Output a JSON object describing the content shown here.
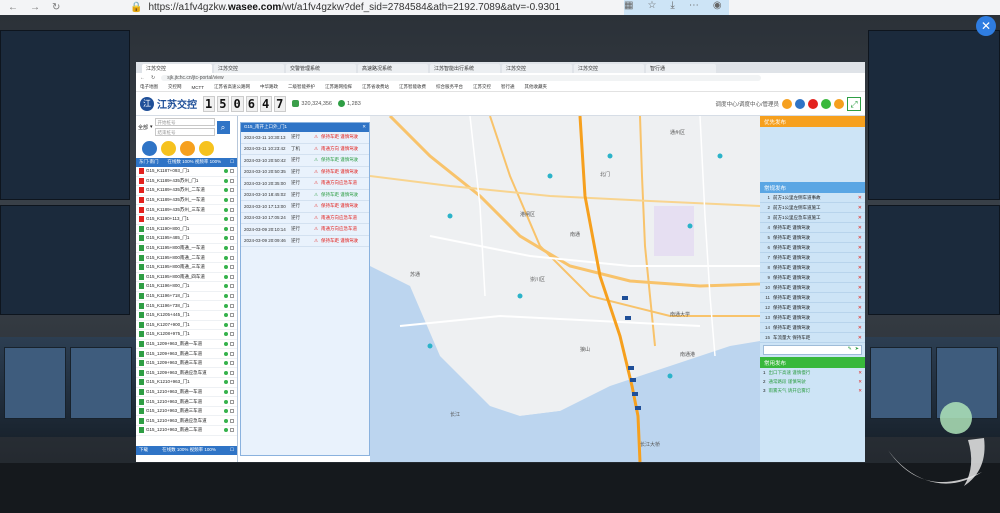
{
  "outer_browser": {
    "url_prefix": "https://a1fv4gzkw.",
    "url_domain": "wasee.com",
    "url_rest": "/wt/a1fv4gzkw?def_sid=2784584&ath=2192.7089&atv=-0.9301"
  },
  "inner_browser": {
    "tabs": [
      "江苏交控",
      "江苏交控",
      "交警管理系统",
      "高速路况系统",
      "江苏智能出行系统",
      "江苏交控",
      "江苏交控",
      "智行通"
    ],
    "address": "sjk.jtchc.cn/jtc-portal/view",
    "bookmarks": [
      "电子地图",
      "交控网",
      "MCTT",
      "江苏省高速公路网",
      "中华路政",
      "二级智能养护",
      "江苏路网指挥",
      "江苏省收费站",
      "江苏智能收费",
      "综合服务平台",
      "江苏交控",
      "智行通",
      "其他收藏夹"
    ]
  },
  "app": {
    "brand_seal": "江",
    "brand_name": "江苏交控",
    "clock": [
      "1",
      "5",
      "0",
      "6",
      "4",
      "7"
    ],
    "stat_a": "320,324,356",
    "stat_b": "1,283",
    "header_right": "调度中心/调度中心/管理员",
    "expand_icon": "⤢"
  },
  "left_panel": {
    "dropdown": "全部",
    "start_placeholder": "开始桩号",
    "end_placeholder": "结束桩号",
    "search_icon": "⌕",
    "list_header_left": "东门-南门",
    "list_header_mid": "在线数 100% 视频率 100%",
    "rows": [
      {
        "label": "G15_K1187+093_门1",
        "tag": "#e3211d"
      },
      {
        "label": "G15_K1189+435苏州_门1",
        "tag": "#e3211d"
      },
      {
        "label": "G15_K1189+435苏州_二车道",
        "tag": "#e3211d"
      },
      {
        "label": "G15_K1189+435苏州_一车道",
        "tag": "#e3211d"
      },
      {
        "label": "G15_K1189+435苏州_三车道",
        "tag": "#e3211d"
      },
      {
        "label": "G15_K1190+113_门1",
        "tag": "#e3211d"
      },
      {
        "label": "G15_K1190+800_门1",
        "tag": "#2e9e44"
      },
      {
        "label": "G15_K1195+485_门1",
        "tag": "#2e9e44"
      },
      {
        "label": "G15_K1195+800南通_一车道",
        "tag": "#2e9e44"
      },
      {
        "label": "G15_K1195+800南通_二车道",
        "tag": "#2e9e44"
      },
      {
        "label": "G15_K1195+800南通_三车道",
        "tag": "#2e9e44"
      },
      {
        "label": "G15_K1195+800南通_四车道",
        "tag": "#2e9e44"
      },
      {
        "label": "G15_K1196+800_门1",
        "tag": "#2e9e44"
      },
      {
        "label": "G15_K1196+718_门1",
        "tag": "#2e9e44"
      },
      {
        "label": "G15_K1196+738_门1",
        "tag": "#2e9e44"
      },
      {
        "label": "G15_K1205+445_门1",
        "tag": "#2e9e44"
      },
      {
        "label": "G15_K1207+900_门1",
        "tag": "#2e9e44"
      },
      {
        "label": "G15_K1208+975_门1",
        "tag": "#2e9e44"
      },
      {
        "label": "G15_1209+963_南通一车道",
        "tag": "#2e9e44"
      },
      {
        "label": "G15_1209+963_南通二车道",
        "tag": "#2e9e44"
      },
      {
        "label": "G15_1209+963_南通三车道",
        "tag": "#2e9e44"
      },
      {
        "label": "G15_1209+963_南通应急车道",
        "tag": "#2e9e44"
      },
      {
        "label": "G15_K1210+963_门1",
        "tag": "#2e9e44"
      },
      {
        "label": "G15_1210+963_南通一车道",
        "tag": "#2e9e44"
      },
      {
        "label": "G15_1210+963_南通二车道",
        "tag": "#2e9e44"
      },
      {
        "label": "G15_1210+963_南通三车道",
        "tag": "#2e9e44"
      },
      {
        "label": "G15_1210+963_南通应急车道",
        "tag": "#2e9e44"
      },
      {
        "label": "G15_1210+963_南通二车道",
        "tag": "#2e9e44"
      }
    ],
    "list_footer_left": "下载",
    "list_footer_mid": "在线数 100% 视频率 100%"
  },
  "event_panel": {
    "title": "G15_南开上口外_门1",
    "events": [
      {
        "date": "2024-03-11 10:30:13",
        "kind": "逆行",
        "status": "保持车距 谨慎驾驶",
        "color": "red"
      },
      {
        "date": "2024-03-11 10:23:42",
        "kind": "丁机",
        "status": "南通方向 谨慎驾驶",
        "color": "red"
      },
      {
        "date": "2024-03-10 20:50:42",
        "kind": "逆行",
        "status": "保持车距 谨慎驾驶",
        "color": "green"
      },
      {
        "date": "2024-03-10 20:50:35",
        "kind": "逆行",
        "status": "保持车距 谨慎驾驶",
        "color": "red"
      },
      {
        "date": "2024-03-10 20:35:00",
        "kind": "逆行",
        "status": "南通方向应急车道",
        "color": "red"
      },
      {
        "date": "2024-03-10 18:45:02",
        "kind": "逆行",
        "status": "保持车距 谨慎驾驶",
        "color": "green"
      },
      {
        "date": "2024-03-10 17:13:00",
        "kind": "逆行",
        "status": "保持车距 谨慎驾驶",
        "color": "red"
      },
      {
        "date": "2024-03-10 17:05:24",
        "kind": "逆行",
        "status": "南通方向应急车道",
        "color": "red"
      },
      {
        "date": "2024-03-09 20:10:14",
        "kind": "逆行",
        "status": "南通方向应急车道",
        "color": "red"
      },
      {
        "date": "2024-03-09 20:09:46",
        "kind": "逆行",
        "status": "保持车距 谨慎驾驶",
        "color": "red"
      }
    ]
  },
  "map": {
    "labels": [
      "通州区",
      "南通",
      "崇川区",
      "港闸区",
      "北门",
      "南通大学",
      "狼山",
      "长江",
      "南通港",
      "长江大桥",
      "苏通"
    ]
  },
  "right_panel": {
    "section1_title": "优先发布",
    "section2_title": "常规发布",
    "section2_items": [
      "前方1公里左侧车道事故",
      "前方1公里左侧车道施工",
      "前方1公里应急车道施工",
      "保持车距 谨慎驾驶",
      "保持车距 谨慎驾驶",
      "保持车距 谨慎驾驶",
      "保持车距 谨慎驾驶",
      "保持车距 谨慎驾驶",
      "保持车距 谨慎驾驶",
      "保持车距 谨慎驾驶",
      "保持车距 谨慎驾驶",
      "保持车距 谨慎驾驶",
      "保持车距 谨慎驾驶",
      "保持车距 谨慎驾驶",
      "车流量大 保持车距"
    ],
    "section3_title": "常用发布",
    "section3_items": [
      "出口下高速 谨慎慢行",
      "通常路段 谨慎驾驶",
      "雨雾天气 请开启雾灯"
    ]
  },
  "colors": {
    "accent_blue": "#2f74c6",
    "orange": "#f6a01e",
    "green": "#38b83b",
    "red": "#e3211d"
  }
}
